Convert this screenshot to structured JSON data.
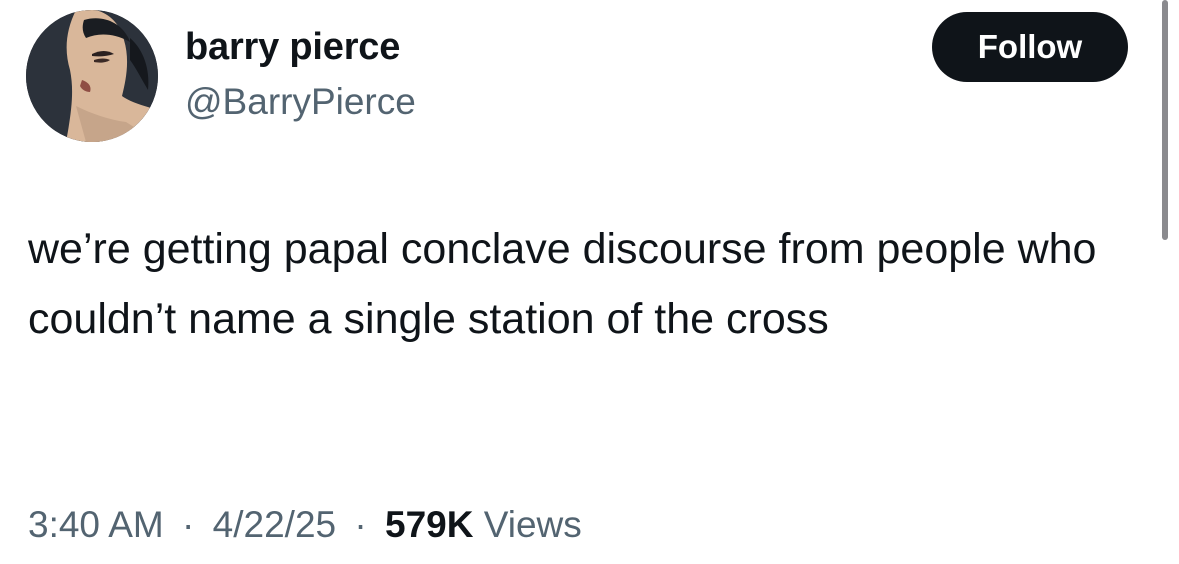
{
  "author": {
    "display_name": "barry pierce",
    "handle": "@BarryPierce"
  },
  "follow_label": "Follow",
  "tweet": {
    "text": "we’re getting papal conclave discourse from people who couldn’t name a single station of the cross"
  },
  "meta": {
    "time": "3:40 AM",
    "separator": "·",
    "date": "4/22/25",
    "views_count": "579K",
    "views_label": "Views"
  },
  "colors": {
    "text": "#0f1419",
    "secondary": "#536471",
    "button_bg": "#0f1419",
    "button_text": "#ffffff"
  }
}
